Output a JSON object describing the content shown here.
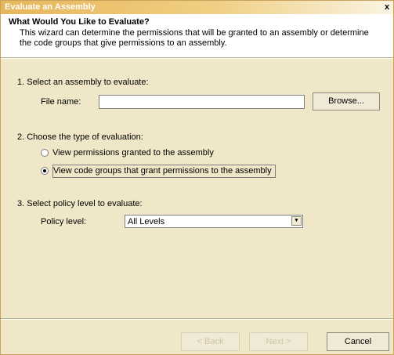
{
  "window": {
    "title": "Evaluate an Assembly",
    "close_glyph": "x"
  },
  "header": {
    "title": "What Would You Like to Evaluate?",
    "description": "This wizard can determine the permissions that will be granted to an assembly or determine the code groups that give permissions to an assembly."
  },
  "step1": {
    "heading": "1. Select an assembly to evaluate:",
    "file_label": "File name:",
    "file_value": "",
    "browse_label": "Browse..."
  },
  "step2": {
    "heading": "2. Choose the type of evaluation:",
    "options": [
      {
        "label": "View permissions granted to the assembly",
        "selected": false
      },
      {
        "label": "View code groups that grant permissions to the assembly",
        "selected": true
      }
    ]
  },
  "step3": {
    "heading": "3. Select policy level to evaluate:",
    "policy_label": "Policy level:",
    "policy_value": "All Levels"
  },
  "footer": {
    "back_label": "< Back",
    "next_label": "Next >",
    "cancel_label": "Cancel"
  },
  "icons": {
    "close": "close-icon",
    "dropdown": "chevron-down-icon"
  },
  "colors": {
    "titlebar": "#e7b65a",
    "dialog_bg": "#efe7c7",
    "header_bg": "#ffffff"
  }
}
